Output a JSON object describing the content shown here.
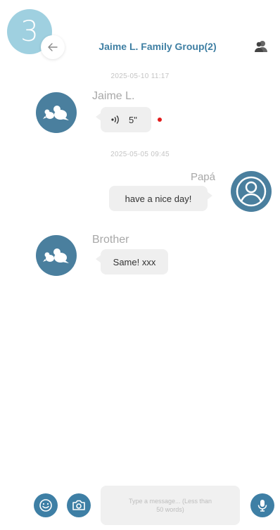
{
  "step_number": "3",
  "header": {
    "title": "Jaime L. Family Group(2)"
  },
  "messages": [
    {
      "timestamp": "2025-05-10 11:17",
      "sender": "Jaime L.",
      "side": "left",
      "type": "voice",
      "voice_duration": "5\"",
      "unread": true
    },
    {
      "timestamp": "2025-05-05 09:45",
      "sender": "Papá",
      "side": "right",
      "type": "text",
      "text": "have a nice day!"
    },
    {
      "sender": "Brother",
      "side": "left",
      "type": "text",
      "text": "Same! xxx"
    }
  ],
  "composer": {
    "placeholder": "Type a message... (Less than 50 words)"
  },
  "colors": {
    "accent": "#3e7fa5",
    "badge": "#9fd0e0",
    "bubble": "#efefef",
    "unread_dot": "#e21b1b"
  },
  "icons": [
    "back-arrow-icon",
    "group-members-icon",
    "bird-avatar-icon",
    "person-avatar-icon",
    "speaker-icon",
    "emoji-icon",
    "camera-icon",
    "microphone-icon"
  ]
}
